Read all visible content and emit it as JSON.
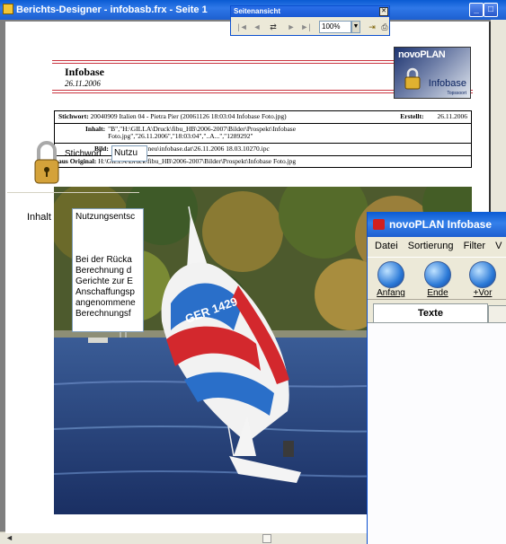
{
  "designer": {
    "title": "Berichts-Designer - infobasb.frx - Seite 1"
  },
  "report": {
    "title": "Infobase",
    "date": "26.11.2006",
    "logo": {
      "brand": "novoPLAN",
      "product": "Infobase",
      "tag": "Topssoort"
    },
    "rows": [
      {
        "label": "Stichwort:",
        "value": "20040909 Italien 04 - Pietra Pier (20061126 18:03:04 Infobase Foto.jpg)",
        "extra_label": "Erstellt:",
        "extra_value": "26.11.2006"
      },
      {
        "label": "Inhalt:",
        "value": "\"B\",\"H:\\GILLA\\Druck\\fibu_HB\\2006-2007\\Bilder\\Prospekt\\Infobase Foto.jpg\",\"26.11.2006\",\"18:03:04\",\"..A...\",\"1289292\""
      },
      {
        "label": "Bild:",
        "value": "d:\\fotoalbum neu\\infobase.dat\\26.11.2006 18.03.10270.ipc"
      },
      {
        "label": "aus Original:",
        "value": "H:\\GILLA\\Druck\\fibu_HB\\2006-2007\\Bilder\\Prospekt\\Infobase Foto.jpg"
      }
    ],
    "sail_text": "GER 1429"
  },
  "seitenansicht": {
    "title": "Seitenansicht",
    "zoom": "100%"
  },
  "novoplan": {
    "title": "novoPLAN Infobase",
    "menu": [
      "Datei",
      "Sortierung",
      "Filter",
      "V"
    ],
    "toolbar": [
      {
        "label": "Anfang",
        "icon": "anchor-icon"
      },
      {
        "label": "Ende",
        "icon": "anchor-end-icon"
      },
      {
        "label": "+Vor",
        "icon": "forward-icon"
      }
    ],
    "active_tab": "Texte",
    "stichwort_label": "Stichwort",
    "stichwort_value": "Nutzu",
    "inhalt_label": "Inhalt",
    "inhalt_lines": [
      "Nutzungsentsc",
      "",
      "",
      "",
      "Bei der Rücka",
      "Berechnung d",
      "Gerichte zur E",
      "Anschaffungsp",
      "angenommene",
      "Berechnungsf"
    ]
  }
}
